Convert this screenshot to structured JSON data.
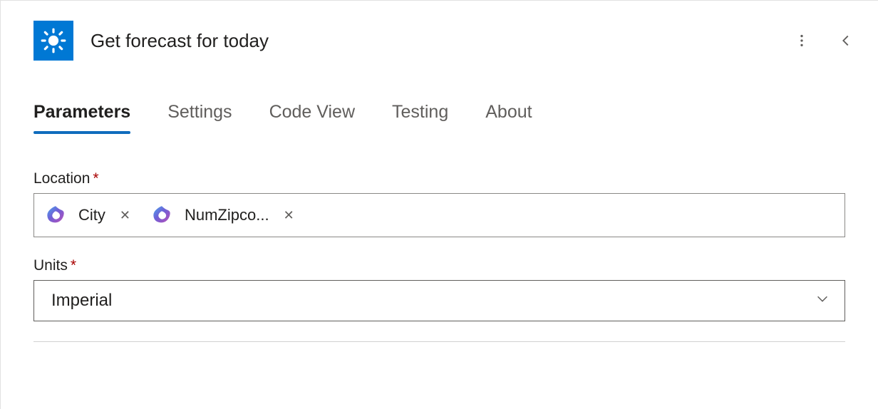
{
  "header": {
    "title": "Get forecast for today",
    "connector_icon": "sun-icon",
    "more_icon": "more-vertical-icon",
    "collapse_icon": "chevron-left-icon"
  },
  "tabs": [
    {
      "label": "Parameters",
      "active": true
    },
    {
      "label": "Settings",
      "active": false
    },
    {
      "label": "Code View",
      "active": false
    },
    {
      "label": "Testing",
      "active": false
    },
    {
      "label": "About",
      "active": false
    }
  ],
  "fields": {
    "location": {
      "label": "Location",
      "required": true,
      "tokens": [
        {
          "label": "City",
          "icon": "copilot-icon"
        },
        {
          "label": "NumZipco...",
          "icon": "copilot-icon"
        }
      ]
    },
    "units": {
      "label": "Units",
      "required": true,
      "selected": "Imperial"
    }
  }
}
